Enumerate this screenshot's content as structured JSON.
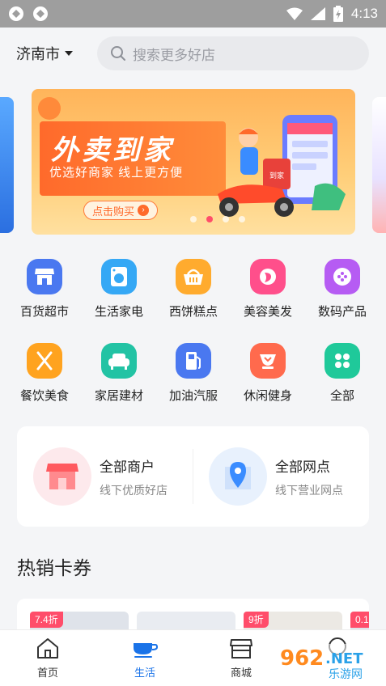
{
  "status_bar": {
    "time": "4:13"
  },
  "header": {
    "city": "济南市",
    "search_placeholder": "搜索更多好店"
  },
  "banner": {
    "title": "外卖到家",
    "subtitle": "优选好商家  线上更方便",
    "cta": "点击购买",
    "sign_text": "到家",
    "dots": 4,
    "active_dot": 2
  },
  "categories": [
    {
      "label": "百货超市",
      "icon": "store-icon",
      "color": "#4a78f0"
    },
    {
      "label": "生活家电",
      "icon": "washing-machine-icon",
      "color": "#35a8f5"
    },
    {
      "label": "西饼糕点",
      "icon": "bread-basket-icon",
      "color": "#ffab2e"
    },
    {
      "label": "美容美发",
      "icon": "beauty-icon",
      "color": "#ff4f8b"
    },
    {
      "label": "数码产品",
      "icon": "digital-icon",
      "color": "#b65cf3"
    },
    {
      "label": "餐饮美食",
      "icon": "cutlery-icon",
      "color": "#ffa31f"
    },
    {
      "label": "家居建材",
      "icon": "sofa-icon",
      "color": "#22c3a4"
    },
    {
      "label": "加油汽服",
      "icon": "fuel-pump-icon",
      "color": "#4a78f0"
    },
    {
      "label": "休闲健身",
      "icon": "fitness-icon",
      "color": "#ff6a4d"
    },
    {
      "label": "全部",
      "icon": "grid-icon",
      "color": "#1fc99a"
    }
  ],
  "merchant_card": {
    "left": {
      "title": "全部商户",
      "subtitle": "线下优质好店"
    },
    "right": {
      "title": "全部网点",
      "subtitle": "线下营业网点"
    }
  },
  "hot_section": {
    "title": "热销卡券"
  },
  "coupons": [
    {
      "tag": "7.4折"
    },
    {
      "tag": ""
    },
    {
      "tag": "9折"
    },
    {
      "tag": "0.1"
    }
  ],
  "tabbar": [
    {
      "label": "首页",
      "icon": "home-icon",
      "active": false
    },
    {
      "label": "生活",
      "icon": "cup-icon",
      "active": true
    },
    {
      "label": "商城",
      "icon": "shop-icon",
      "active": false
    }
  ],
  "watermark": {
    "number": "962",
    "suffix": ".NET",
    "sub": "乐游网"
  },
  "colors": {
    "accent": "#1a73e8",
    "banner_orange": "#ff6a2b",
    "tag_red": "#ff4d6a"
  }
}
